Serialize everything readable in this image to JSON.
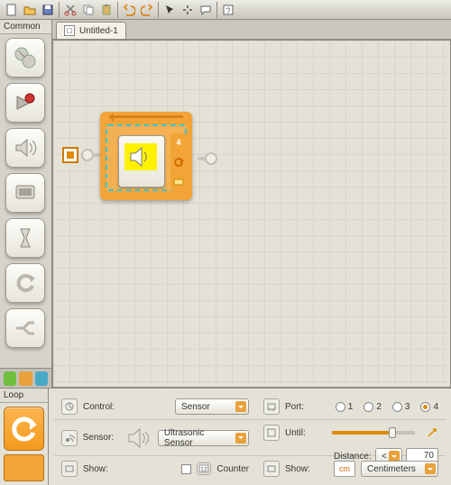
{
  "toolbar": {
    "items": [
      "new",
      "open",
      "save",
      "cut",
      "copy",
      "paste",
      "undo",
      "redo",
      "pointer",
      "pan",
      "comment",
      "help"
    ]
  },
  "palette": {
    "title": "Common",
    "items": [
      "move-block",
      "record-block",
      "sound-block",
      "display-block",
      "wait-block",
      "loop-block",
      "switch-block"
    ]
  },
  "tabs": [
    {
      "label": "Untitled-1"
    }
  ],
  "canvas": {
    "loop_port_badge": "4"
  },
  "cfg": {
    "panel_title": "Loop",
    "control_label": "Control:",
    "control_value": "Sensor",
    "sensor_label": "Sensor:",
    "sensor_value": "Ultrasonic Sensor",
    "show_label": "Show:",
    "counter_label": "Counter",
    "port_label": "Port:",
    "ports": [
      "1",
      "2",
      "3",
      "4"
    ],
    "port_selected": 4,
    "until_label": "Until:",
    "distance_label": "Distance:",
    "distance_op": "<",
    "distance_value": "70",
    "unit_value": "cm",
    "unit_select": "Centimeters"
  }
}
